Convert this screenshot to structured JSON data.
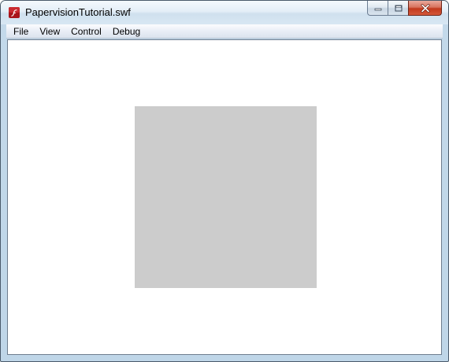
{
  "window": {
    "title": "PapervisionTutorial.swf",
    "icon": "flash-player-icon",
    "caption_buttons": [
      {
        "name": "minimize-button",
        "icon": "minimize-icon"
      },
      {
        "name": "maximize-button",
        "icon": "maximize-icon"
      },
      {
        "name": "close-button",
        "icon": "close-icon"
      }
    ]
  },
  "menubar": {
    "items": [
      {
        "label": "File"
      },
      {
        "label": "View"
      },
      {
        "label": "Control"
      },
      {
        "label": "Debug"
      }
    ]
  },
  "stage": {
    "background": "#ffffff",
    "square_color": "#cccccc"
  },
  "colors": {
    "close_button": "#c2391c",
    "frame": "#c3d9ea"
  }
}
